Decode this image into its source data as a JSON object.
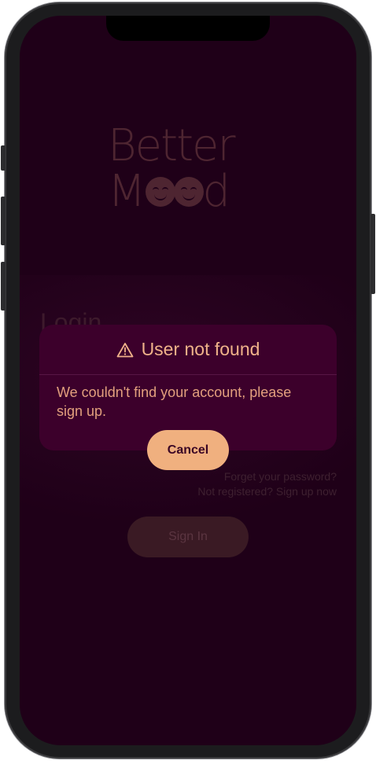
{
  "app": {
    "logo_line1": "Better",
    "logo_line2_prefix": "M",
    "logo_line2_suffix": "d"
  },
  "login": {
    "title": "Login",
    "forgot_password": "Forget your password?",
    "register": "Not registered? Sign up now",
    "sign_in_label": "Sign In"
  },
  "alert": {
    "icon": "warning-triangle-icon",
    "title": "User not found",
    "message": "We couldn't find your account, please sign up.",
    "cancel_label": "Cancel"
  },
  "colors": {
    "background": "#1f0018",
    "alert_bg": "#3c002b",
    "accent": "#f0b07f"
  }
}
